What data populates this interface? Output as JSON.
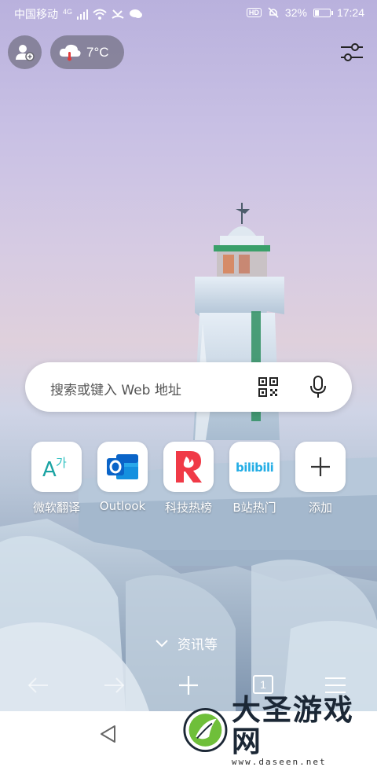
{
  "status_bar": {
    "carrier": "中国移动",
    "network_type": "4G",
    "battery_percent": "32%",
    "battery_level": 0.32,
    "time": "17:24",
    "hd_badge": "HD",
    "icons": [
      "signal-icon",
      "wifi-icon",
      "missed-call-icon",
      "chat-icon",
      "mute-icon",
      "battery-icon"
    ]
  },
  "header": {
    "profile_icon": "add-profile-icon",
    "weather": {
      "temperature": "7°C",
      "icon": "cloud-rain-icon"
    },
    "settings_icon": "sliders-icon"
  },
  "search": {
    "placeholder": "搜索或键入 Web 地址",
    "qr_icon": "qr-scan-icon",
    "mic_icon": "microphone-icon"
  },
  "shortcuts": [
    {
      "label": "微软翻译",
      "icon": "translator-icon",
      "colors": [
        "#1aa3a3",
        "#2fc0c0"
      ]
    },
    {
      "label": "Outlook",
      "icon": "outlook-icon",
      "colors": [
        "#0a64c8",
        "#28a8ea"
      ]
    },
    {
      "label": "科技热榜",
      "icon": "r-flame-icon",
      "colors": [
        "#f03a47",
        "#ff6a3d"
      ]
    },
    {
      "label": "B站热门",
      "icon": "bilibili-icon",
      "colors": [
        "#23ade5"
      ]
    },
    {
      "label": "添加",
      "icon": "plus-icon",
      "colors": [
        "#333333"
      ]
    }
  ],
  "news_toggle": {
    "label": "资讯等",
    "icon": "chevron-down-icon"
  },
  "toolbar": {
    "back_icon": "arrow-left-icon",
    "forward_icon": "arrow-right-icon",
    "new_tab_icon": "plus-icon",
    "tab_count": "1",
    "menu_icon": "hamburger-icon"
  },
  "navbar": {
    "back_icon": "triangle-back-icon"
  },
  "watermark": {
    "text": "大圣游戏网",
    "url": "www.daseen.net"
  }
}
